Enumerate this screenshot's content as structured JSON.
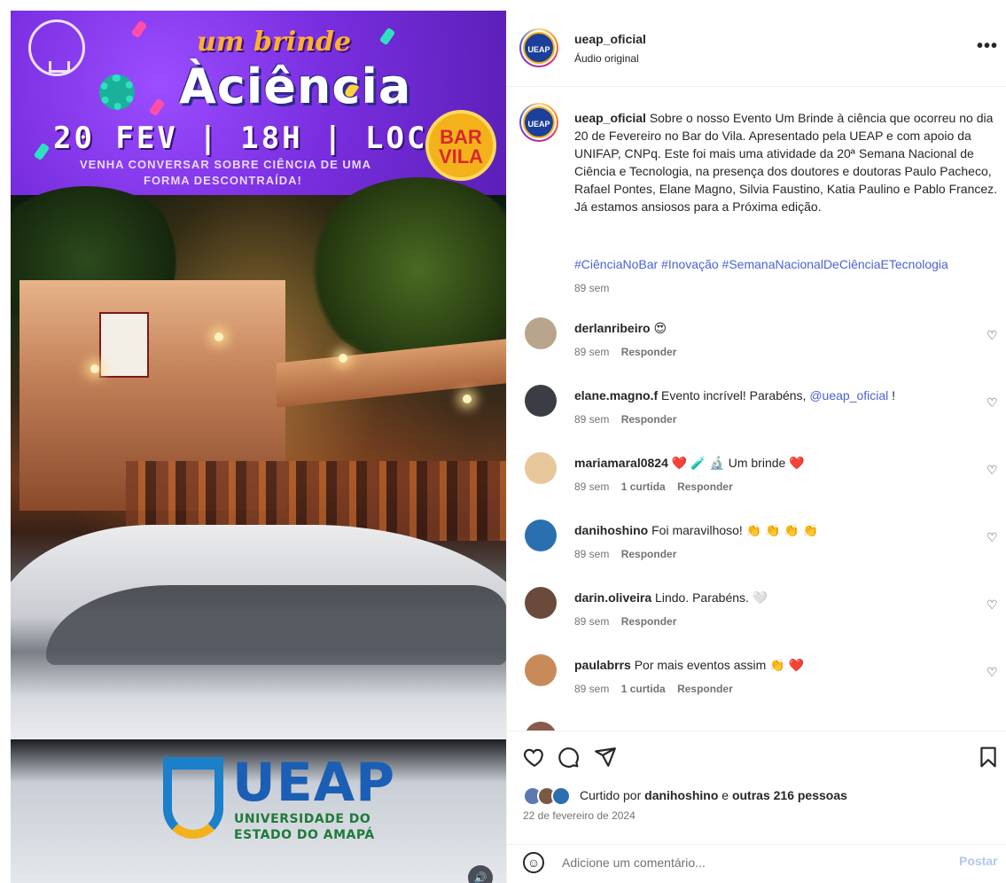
{
  "media": {
    "banner": {
      "title_top": "um brinde",
      "title_main": "Àciência",
      "date_line": "20 FEV | 18H | LOCAL",
      "subtitle_1": "VENHA CONVERSAR SOBRE CIÊNCIA DE UMA",
      "subtitle_2": "FORMA DESCONTRAÍDA!",
      "badge": "BAR VILA",
      "palette": {
        "background": "#7a2fe0",
        "accent": "#ffb02e"
      }
    },
    "logo": {
      "word": "UEAP",
      "line1": "UNIVERSIDADE DO",
      "line2": "ESTADO DO AMAPÁ"
    },
    "volume_icon": "speaker-icon"
  },
  "post": {
    "header": {
      "username": "ueap_oficial",
      "audio": "Áudio original",
      "avatar_text": "UEAP",
      "more": "•••"
    },
    "caption": {
      "username": "ueap_oficial",
      "text": "Sobre o nosso Evento Um Brinde à ciência que ocorreu no dia 20 de Fevereiro no Bar do Vila. Apresentado pela UEAP e com apoio da UNIFAP, CNPq. Este foi mais uma atividade da 20ª Semana Nacional de Ciência e Tecnologia, na presença dos doutores e doutoras Paulo Pacheco, Rafael Pontes, Elane Magno, Silvia Faustino, Katia Paulino e Pablo Francez. Já estamos ansiosos para a Próxima edição.",
      "hashtags": "#CiênciaNoBar #Inovação #SemanaNacionalDeCiênciaETecnologia",
      "time": "89 sem"
    },
    "comments": [
      {
        "username": "derlanribeiro",
        "text": "😍",
        "time": "89 sem",
        "likes": "",
        "reply": "Responder",
        "avatar_color": "#b9a58c"
      },
      {
        "username": "elane.magno.f",
        "text": "Evento incrível! Parabéns,",
        "mention": "@ueap_oficial",
        "after": "!",
        "time": "89 sem",
        "likes": "",
        "reply": "Responder",
        "avatar_color": "#3a3d44"
      },
      {
        "username": "mariamaral0824",
        "text": "❤️ 🧪 🔬 Um brinde ❤️",
        "time": "89 sem",
        "likes": "1 curtida",
        "reply": "Responder",
        "avatar_color": "#e8c79a"
      },
      {
        "username": "danihoshino",
        "text": "Foi maravilhoso! 👏 👏 👏 👏",
        "time": "89 sem",
        "likes": "",
        "reply": "Responder",
        "avatar_color": "#2a6fb0"
      },
      {
        "username": "darin.oliveira",
        "text": "Lindo. Parabéns. 🤍",
        "time": "89 sem",
        "likes": "",
        "reply": "Responder",
        "avatar_color": "#6a4a3a"
      },
      {
        "username": "paulabrrs",
        "text": "Por mais eventos assim 👏 ❤️",
        "time": "89 sem",
        "likes": "1 curtida",
        "reply": "Responder",
        "avatar_color": "#c98a5a"
      }
    ],
    "actions": {
      "like_icon": "heart-icon",
      "comment_icon": "comment-icon",
      "share_icon": "share-icon",
      "save_icon": "bookmark-icon"
    },
    "likes": {
      "prefix": "Curtido por",
      "user": "danihoshino",
      "conj": "e",
      "others": "outras 216 pessoas"
    },
    "date": "22 de fevereiro de 2024",
    "add_comment": {
      "placeholder": "Adicione um comentário...",
      "post_label": "Postar"
    }
  }
}
